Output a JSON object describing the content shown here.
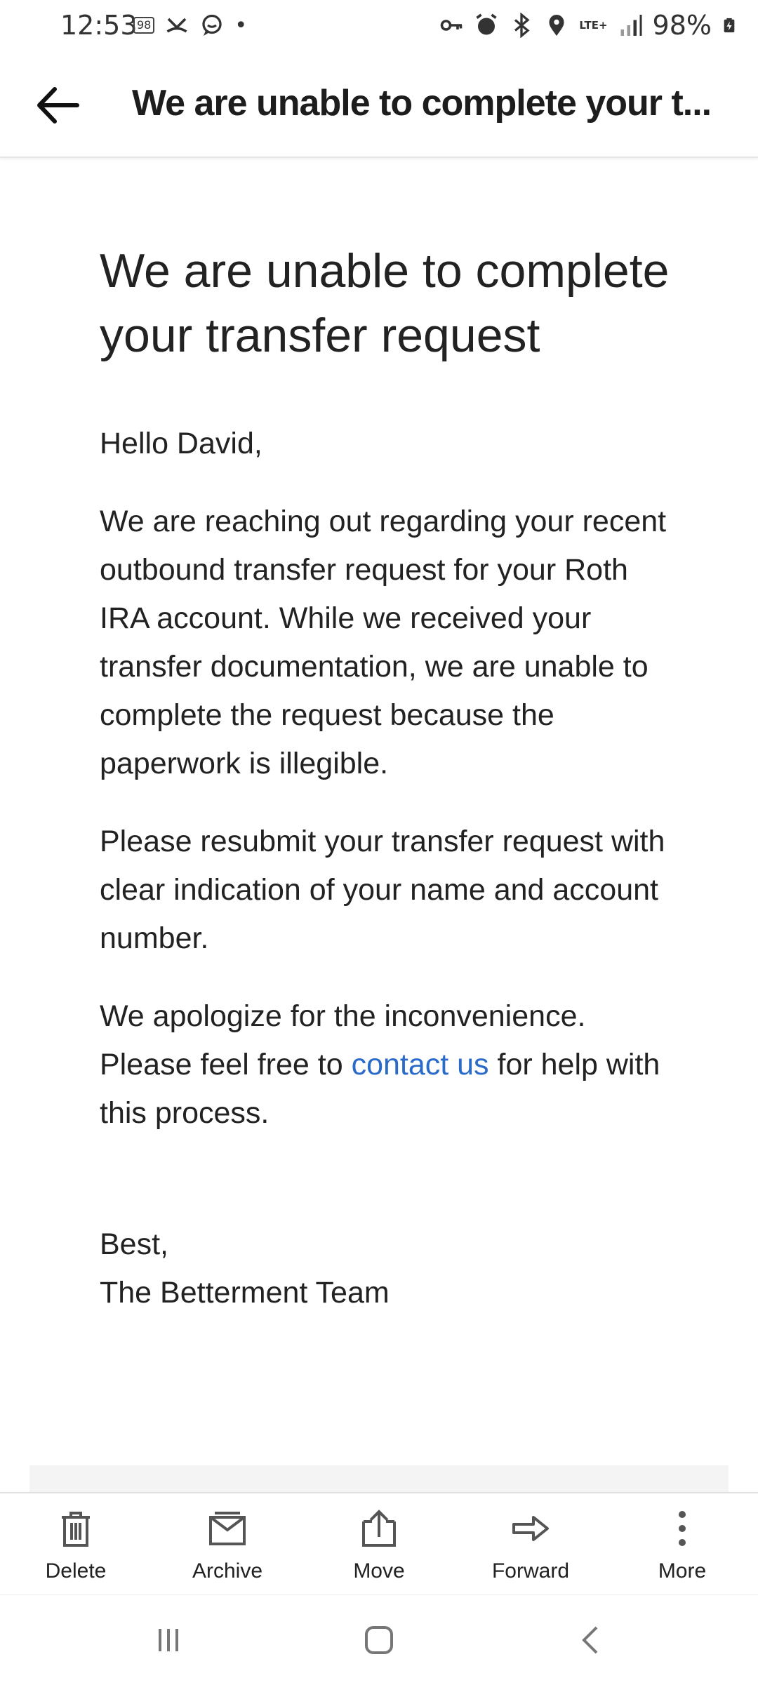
{
  "status_bar": {
    "time": "12:53",
    "notif_badge": "98",
    "network": "LTE+",
    "battery": "98%"
  },
  "header": {
    "back_icon": "back-arrow-icon",
    "title": "We are unable to complete your t..."
  },
  "email": {
    "title": "We are unable to complete your transfer request",
    "greeting": "Hello David,",
    "paragraph1": "We are reaching out regarding your recent outbound transfer request for your Roth IRA account. While we received your transfer documentation, we are unable to complete the request because the paperwork is illegible.",
    "paragraph2": "Please resubmit your transfer request with clear indication of your name and account number.",
    "paragraph3_before": "We apologize for the inconvenience. Please feel free to ",
    "paragraph3_link": "contact us",
    "paragraph3_after": " for help with this process.",
    "signoff": "Best,",
    "signature": "The Betterment Team",
    "link_color": "#2a6ac9"
  },
  "actions": [
    {
      "label": "Delete",
      "icon": "trash-icon"
    },
    {
      "label": "Archive",
      "icon": "archive-icon"
    },
    {
      "label": "Move",
      "icon": "move-icon"
    },
    {
      "label": "Forward",
      "icon": "forward-icon"
    },
    {
      "label": "More",
      "icon": "more-vertical-icon"
    }
  ]
}
